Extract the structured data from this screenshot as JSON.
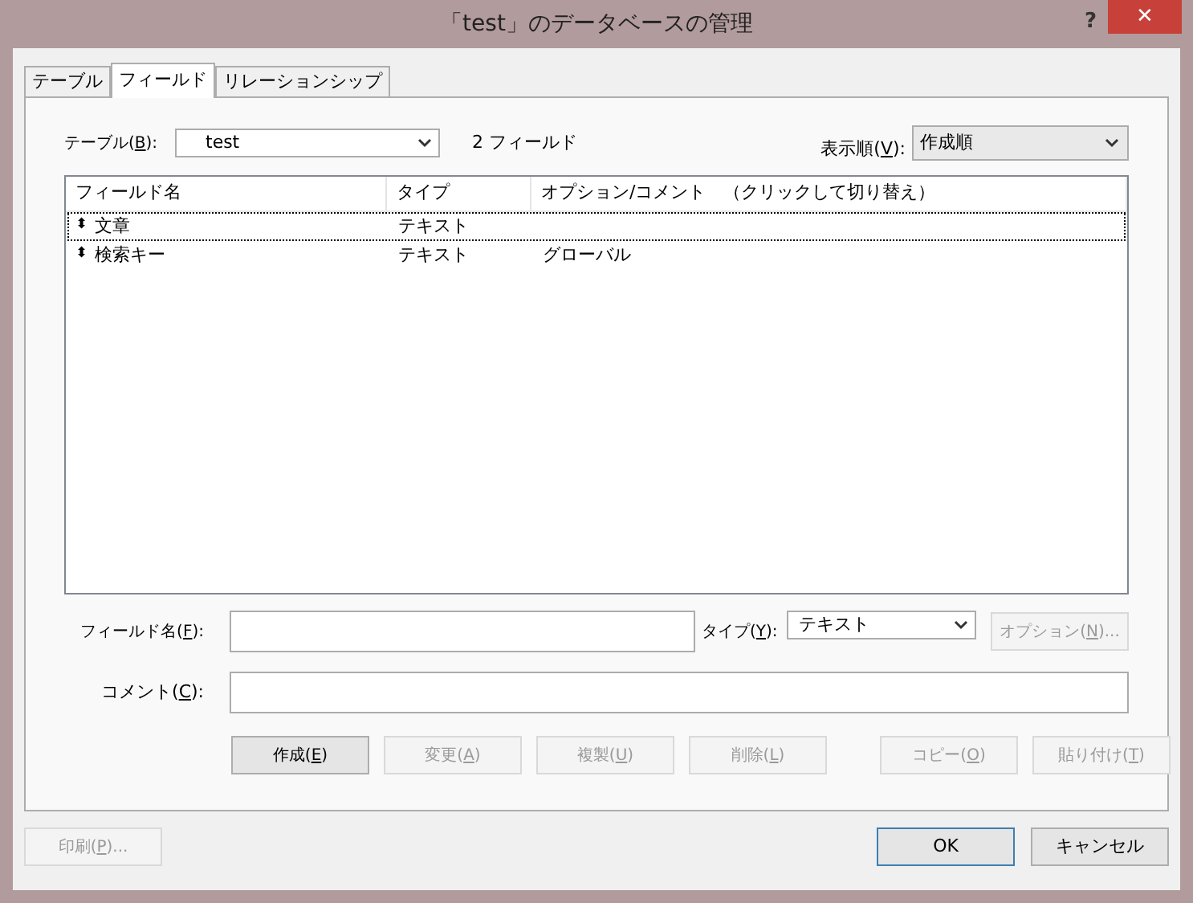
{
  "window": {
    "title": "「test」のデータベースの管理",
    "help": "?",
    "close": "✕"
  },
  "tabs": [
    {
      "label": "テーブル",
      "selected": false
    },
    {
      "label": "フィールド",
      "selected": true
    },
    {
      "label": "リレーションシップ",
      "selected": false
    }
  ],
  "table_select": {
    "label": {
      "before": "テーブル(",
      "key": "B",
      "after": "):"
    },
    "value": "test"
  },
  "field_count": "2 フィールド",
  "sort": {
    "label": {
      "before": "表示順(",
      "key": "V",
      "after": "):"
    },
    "value": "作成順"
  },
  "table": {
    "columns": [
      "フィールド名",
      "タイプ",
      "オプション/コメント　（クリックして切り替え）"
    ],
    "rows": [
      {
        "handle": "⬍",
        "name": "文章",
        "type": "テキスト",
        "options": "",
        "selected": true
      },
      {
        "handle": "⬍",
        "name": "検索キー",
        "type": "テキスト",
        "options": "グローバル",
        "selected": false
      }
    ]
  },
  "field_name": {
    "label": {
      "before": "フィールド名(",
      "key": "F",
      "after": "):"
    }
  },
  "type": {
    "label": {
      "before": "タイプ(",
      "key": "Y",
      "after": "):"
    },
    "value": "テキスト"
  },
  "options_button": {
    "label": {
      "before": "オプション(",
      "key": "N",
      "after": ")..."
    },
    "disabled": true
  },
  "comment": {
    "label": {
      "before": "コメント(",
      "key": "C",
      "after": "):"
    }
  },
  "actions": [
    {
      "label": {
        "before": "作成(",
        "key": "E",
        "after": ")"
      },
      "disabled": false
    },
    {
      "label": {
        "before": "変更(",
        "key": "A",
        "after": ")"
      },
      "disabled": true
    },
    {
      "label": {
        "before": "複製(",
        "key": "U",
        "after": ")"
      },
      "disabled": true
    },
    {
      "label": {
        "before": "削除(",
        "key": "L",
        "after": ")"
      },
      "disabled": true
    },
    {
      "label": {
        "before": "コピー(",
        "key": "O",
        "after": ")"
      },
      "disabled": true
    },
    {
      "label": {
        "before": "貼り付け(",
        "key": "T",
        "after": ")"
      },
      "disabled": true
    }
  ],
  "print_button": {
    "label": {
      "before": "印刷(",
      "key": "P",
      "after": ")..."
    },
    "disabled": true
  },
  "ok_button": {
    "label": "OK",
    "default": true
  },
  "cancel_button": {
    "label": "キャンセル",
    "default": false
  }
}
